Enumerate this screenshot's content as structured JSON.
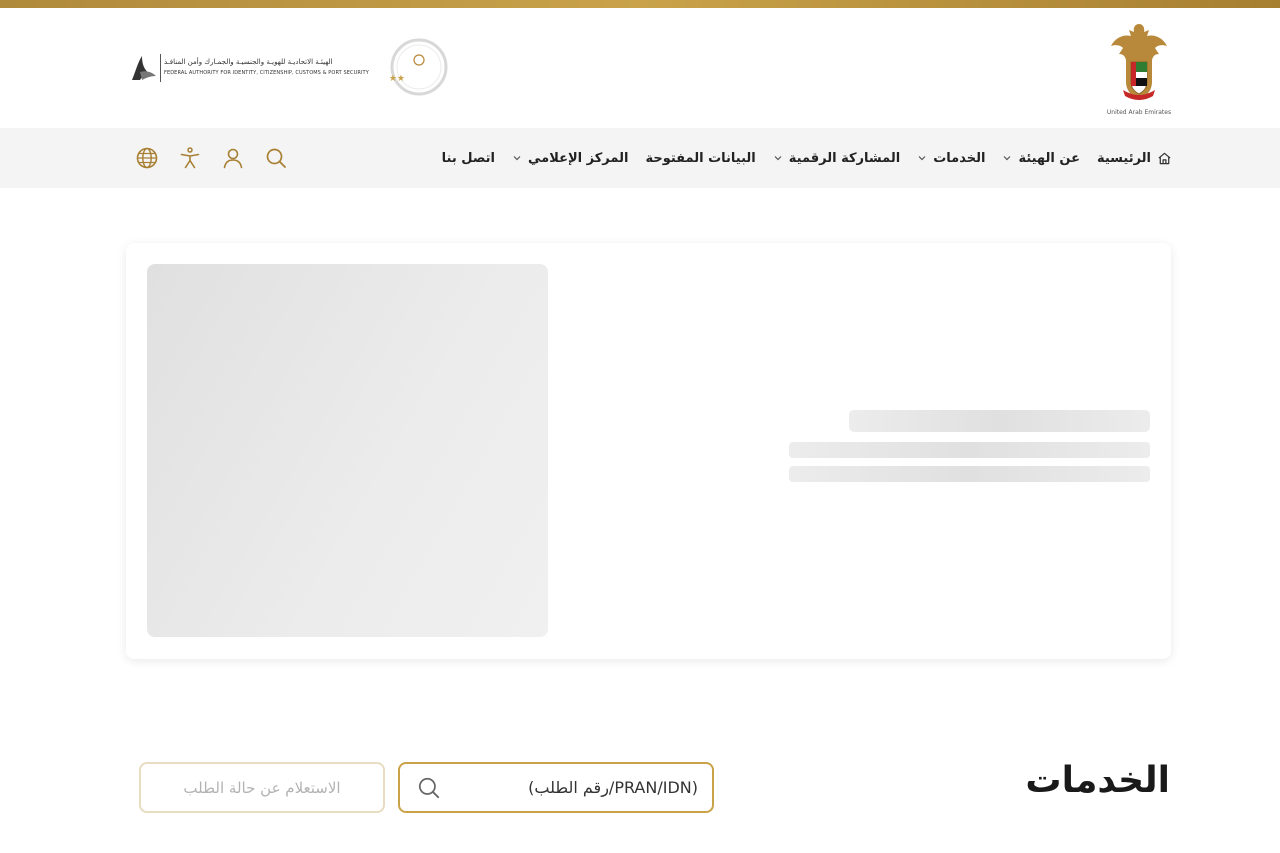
{
  "header": {
    "uae_caption": "United Arab Emirates",
    "authority_name_ar": "الهيئـة الاتحاديـة للهويـة والجنسيـة والجمـارك وأمن المنافـذ",
    "authority_name_en": "FEDERAL AUTHORITY FOR IDENTITY, CITIZENSHIP, CUSTOMS & PORT SECURITY",
    "brand_color": "#c9a24a"
  },
  "nav": {
    "items": [
      {
        "label": "الرئيسية",
        "icon": "home-icon"
      },
      {
        "label": "عن الهيئة",
        "dropdown": true
      },
      {
        "label": "الخدمات",
        "dropdown": true
      },
      {
        "label": "المشاركة الرقمية",
        "dropdown": true
      },
      {
        "label": "البيانات المفتوحة"
      },
      {
        "label": "المركز الإعلامي",
        "dropdown": true
      },
      {
        "label": "اتصل بنا"
      }
    ],
    "tools": [
      "globe-icon",
      "accessibility-icon",
      "user-icon",
      "search-icon"
    ]
  },
  "services": {
    "title": "الخدمات",
    "search_placeholder": "(PRAN/IDN/رقم الطلب)",
    "inquiry_label": "الاستعلام عن حالة الطلب"
  }
}
